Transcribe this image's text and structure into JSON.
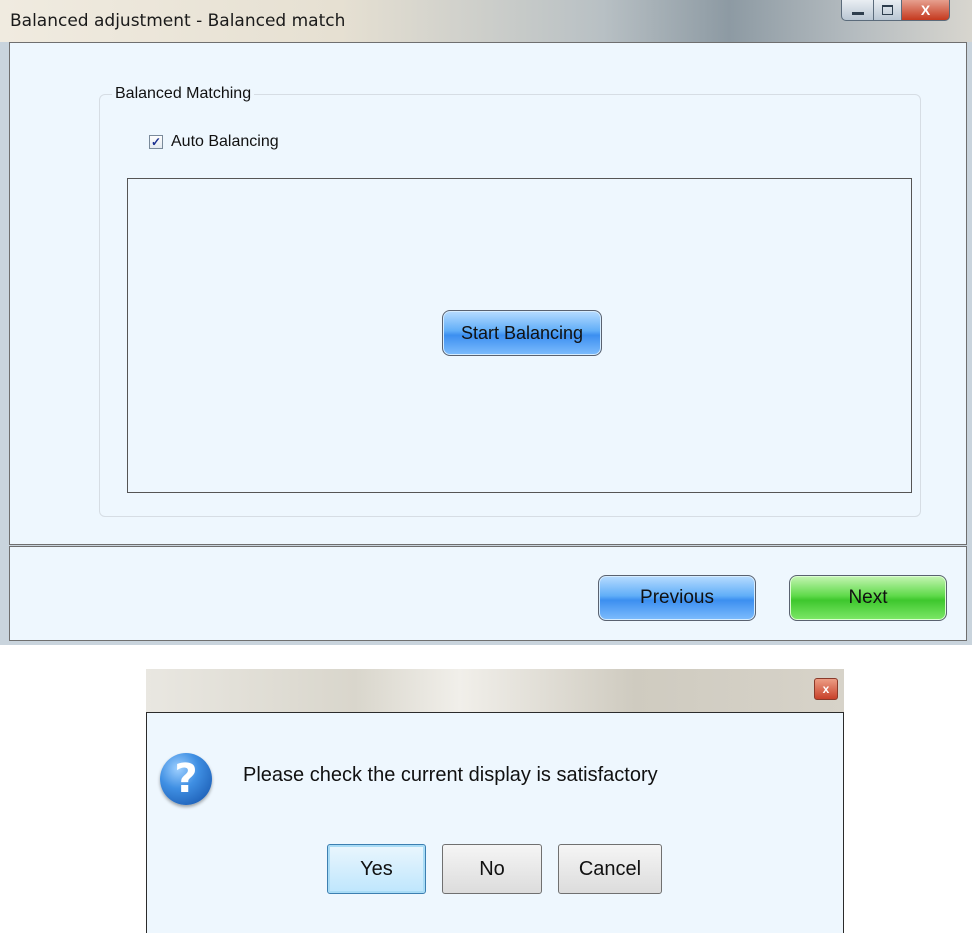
{
  "main_window": {
    "title": "Balanced adjustment - Balanced match",
    "group_title": "Balanced Matching",
    "auto_balancing": {
      "label": "Auto Balancing",
      "checked": true
    },
    "start_button": "Start Balancing",
    "previous_button": "Previous",
    "next_button": "Next",
    "caption_buttons": {
      "close_glyph": "X"
    }
  },
  "dialog": {
    "close_glyph": "x",
    "icon": "question-icon",
    "message": "Please check the current display is satisfactory",
    "yes_button": "Yes",
    "no_button": "No",
    "cancel_button": "Cancel"
  },
  "colors": {
    "content_bg": "#eef7fe",
    "blue_button": "#3c8ff0",
    "green_button": "#3ec72d",
    "close_red": "#c5391e"
  }
}
